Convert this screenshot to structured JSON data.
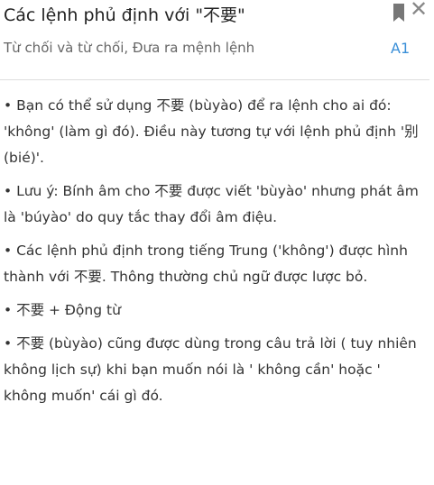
{
  "header": {
    "title": "Các lệnh phủ định với \"不要\"",
    "subtitle": "Từ chối và từ chối, Đưa ra mệnh lệnh",
    "level": "A1",
    "bookmark_icon": "bookmark-icon",
    "close_icon": "close-icon"
  },
  "items": [
    "•  Bạn có thể sử dụng 不要 (bùyào) để ra lệnh cho ai đó: 'không' (làm gì đó). Điều này tương tự với lệnh phủ định '别 (bié)'.",
    "•  Lưu ý: Bính âm cho 不要 được viết 'bùyào' nhưng phát âm là 'búyào' do quy tắc thay đổi âm điệu.",
    "•  Các lệnh phủ định trong tiếng Trung ('không') được hình thành với 不要. Thông thường chủ ngữ được lược bỏ.",
    "•  不要 + Động từ",
    "•  不要 (bùyào) cũng được dùng trong câu trả lời ( tuy nhiên không lịch sự) khi bạn muốn nói là ' không cần' hoặc ' không muốn' cái gì đó."
  ]
}
